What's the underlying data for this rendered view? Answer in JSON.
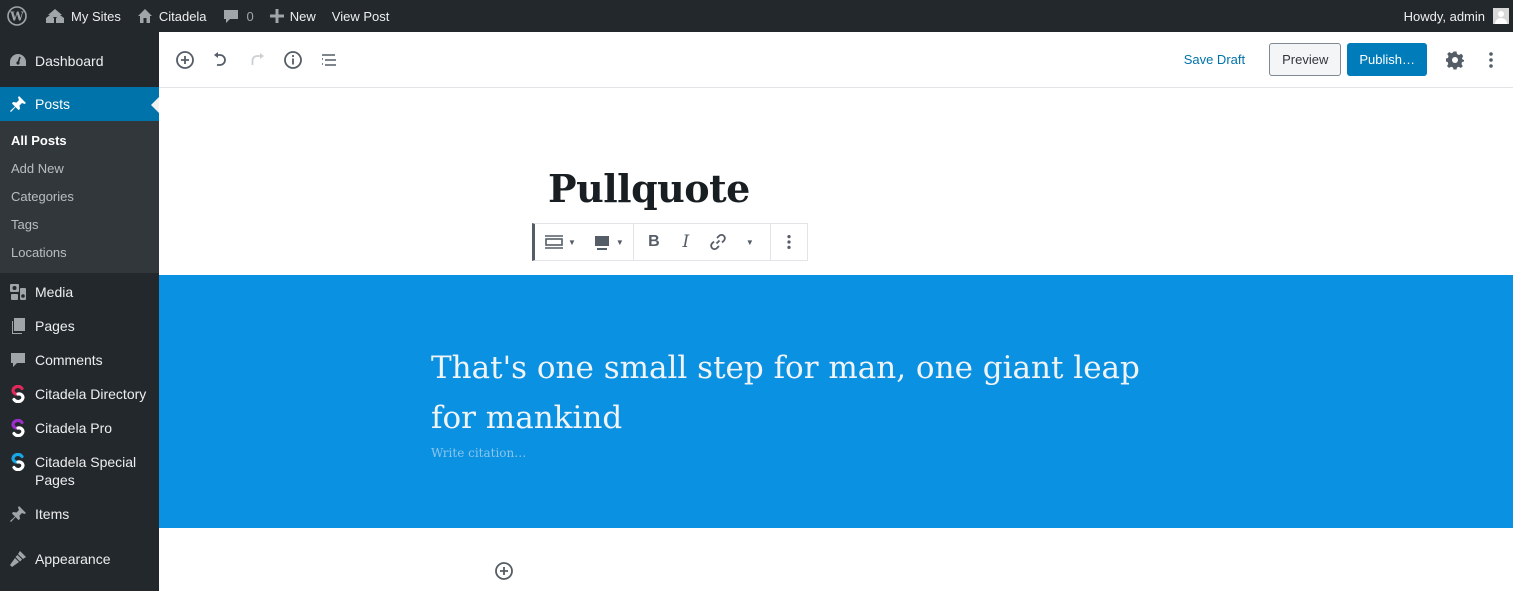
{
  "adminbar": {
    "items": [
      {
        "icon": "wordpress-logo-icon",
        "label": ""
      },
      {
        "icon": "my-sites-icon",
        "label": "My Sites"
      },
      {
        "icon": "home-icon",
        "label": "Citadela"
      },
      {
        "icon": "comment-icon",
        "label": "",
        "count": "0"
      },
      {
        "icon": "plus-icon",
        "label": "New"
      },
      {
        "icon": "",
        "label": "View Post"
      }
    ],
    "greeting": "Howdy, admin"
  },
  "sidebar": {
    "items": [
      {
        "icon": "dashboard-icon",
        "label": "Dashboard"
      },
      {
        "icon": "pin-icon",
        "label": "Posts",
        "current": true
      },
      {
        "icon": "media-icon",
        "label": "Media"
      },
      {
        "icon": "pages-icon",
        "label": "Pages"
      },
      {
        "icon": "comments-icon",
        "label": "Comments"
      },
      {
        "icon": "citadela-directory-icon",
        "label": "Citadela Directory",
        "color": "#e0285a"
      },
      {
        "icon": "citadela-pro-icon",
        "label": "Citadela Pro",
        "color": "#9b2fc8"
      },
      {
        "icon": "citadela-special-pages-icon",
        "label": "Citadela Special Pages",
        "color": "#1aa6e4"
      },
      {
        "icon": "pin-icon",
        "label": "Items"
      },
      {
        "icon": "appearance-icon",
        "label": "Appearance"
      }
    ],
    "submenu": [
      {
        "label": "All Posts",
        "current": true
      },
      {
        "label": "Add New"
      },
      {
        "label": "Categories"
      },
      {
        "label": "Tags"
      },
      {
        "label": "Locations"
      }
    ]
  },
  "editor_header": {
    "tools": [
      "add-block-icon",
      "undo-icon",
      "redo-icon",
      "info-icon",
      "block-navigation-icon"
    ],
    "save_draft": "Save Draft",
    "preview": "Preview",
    "publish": "Publish…"
  },
  "post": {
    "title": "Pullquote",
    "quote": "That's one small step for man, one giant leap for mankind",
    "citation_placeholder": "Write citation…",
    "pullquote_color": "#0a91e1"
  },
  "block_toolbar": {
    "buttons": [
      "change-alignment",
      "change-style",
      "bold",
      "italic",
      "link",
      "more-rich-text",
      "more-options"
    ]
  }
}
